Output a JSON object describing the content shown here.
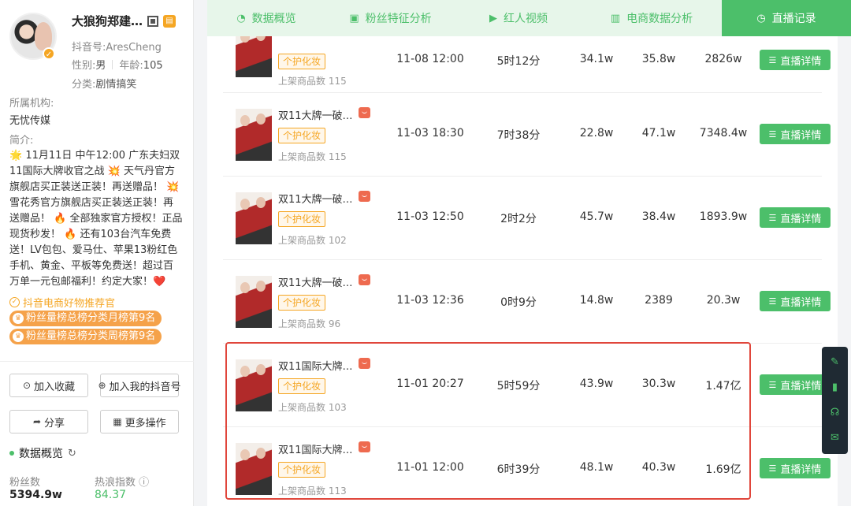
{
  "profile": {
    "name": "大狼狗郑建…",
    "douyin_id": "抖音号:AresCheng",
    "gender_label": "性别:",
    "gender": "男",
    "age_label": "年龄:",
    "age": "105",
    "category_label": "分类:",
    "category": "剧情搞笑",
    "org_label": "所属机构:",
    "org": "无忧传媒",
    "bio_label": "简介:",
    "bio": "🌟 11月11日 中午12:00 广东夫妇双11国际大牌收官之战 💥 天气丹官方旗舰店买正装送正装！再送赠品！ 💥 雪花秀官方旗舰店买正装送正装！再送赠品！ 🔥 全部独家官方授权！正品现货秒发！ 🔥 还有103台汽车免费送！LV包包、爱马仕、苹果13粉红色手机、黄金、平板等免费送！超过百万单一元包邮福利！约定大家！❤️",
    "cert": "抖音电商好物推荐官",
    "rank_tags": [
      "粉丝量榜总榜分类月榜第9名",
      "粉丝量榜总榜分类周榜第9名"
    ]
  },
  "actions": {
    "favorite": "加入收藏",
    "add_mine": "加入我的抖音号",
    "share": "分享",
    "more": "更多操作"
  },
  "overview": {
    "title": "数据概览",
    "fans_label": "粉丝数",
    "fans": "5394.9w",
    "heat_label": "热浪指数",
    "heat": "84.37"
  },
  "tabs": [
    {
      "label": "数据概览",
      "icon": "pie-chart-icon"
    },
    {
      "label": "粉丝特征分析",
      "icon": "id-card-icon"
    },
    {
      "label": "红人视频",
      "icon": "video-icon"
    },
    {
      "label": "电商数据分析",
      "icon": "bar-chart-icon"
    },
    {
      "label": "直播记录",
      "icon": "clock-icon"
    }
  ],
  "detail_label": "直播详情",
  "tag_label": "个护化妆",
  "rows": [
    {
      "title": "",
      "count": "上架商品数 115",
      "time": "11-08 12:00",
      "duration": "5时12分",
      "c1": "34.1w",
      "c2": "35.8w",
      "c3": "2826w"
    },
    {
      "title": "双11大牌一破…",
      "count": "上架商品数 115",
      "time": "11-03 18:30",
      "duration": "7时38分",
      "c1": "22.8w",
      "c2": "47.1w",
      "c3": "7348.4w"
    },
    {
      "title": "双11大牌一破…",
      "count": "上架商品数 102",
      "time": "11-03 12:50",
      "duration": "2时2分",
      "c1": "45.7w",
      "c2": "38.4w",
      "c3": "1893.9w"
    },
    {
      "title": "双11大牌一破…",
      "count": "上架商品数 96",
      "time": "11-03 12:36",
      "duration": "0时9分",
      "c1": "14.8w",
      "c2": "2389",
      "c3": "20.3w"
    },
    {
      "title": "双11国际大牌…",
      "count": "上架商品数 103",
      "time": "11-01 20:27",
      "duration": "5时59分",
      "c1": "43.9w",
      "c2": "30.3w",
      "c3": "1.47亿"
    },
    {
      "title": "双11国际大牌…",
      "count": "上架商品数 113",
      "time": "11-01 12:00",
      "duration": "6时39分",
      "c1": "48.1w",
      "c2": "40.3w",
      "c3": "1.69亿"
    }
  ],
  "colors": {
    "accent": "#4cbf6a",
    "orange": "#f5a623",
    "highlight": "#e0463b"
  }
}
